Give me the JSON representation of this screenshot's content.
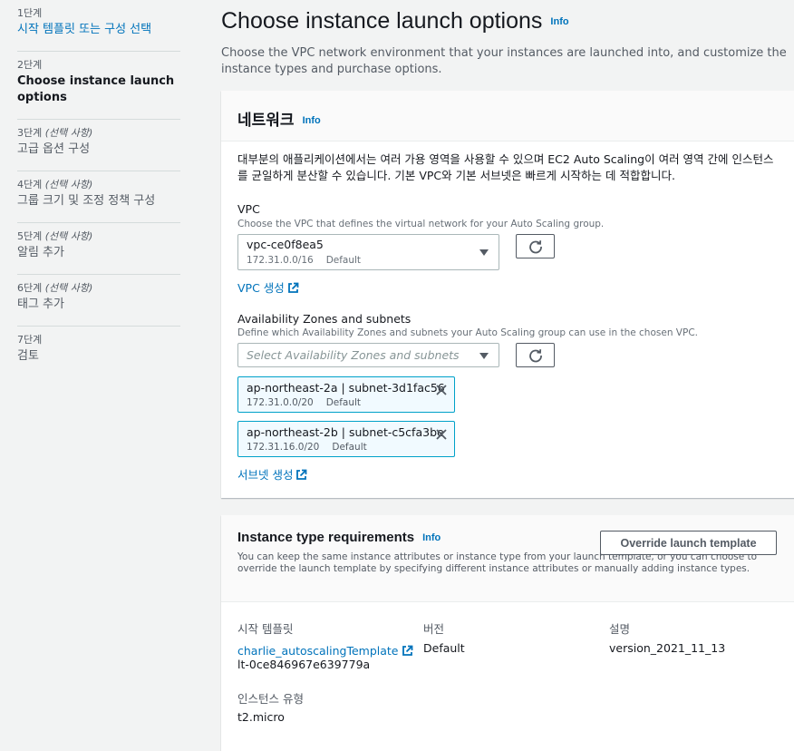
{
  "steps": [
    {
      "num": "1단계",
      "optional": "",
      "title": "시작 템플릿 또는 구성 선택"
    },
    {
      "num": "2단계",
      "optional": "",
      "title": "Choose instance launch options"
    },
    {
      "num": "3단계",
      "optional": "(선택 사항)",
      "title": "고급 옵션 구성"
    },
    {
      "num": "4단계",
      "optional": "(선택 사항)",
      "title": "그룹 크기 및 조정 정책 구성"
    },
    {
      "num": "5단계",
      "optional": "(선택 사항)",
      "title": "알림 추가"
    },
    {
      "num": "6단계",
      "optional": "(선택 사항)",
      "title": "태그 추가"
    },
    {
      "num": "7단계",
      "optional": "",
      "title": "검토"
    }
  ],
  "page": {
    "title": "Choose instance launch options",
    "info": "Info",
    "description": "Choose the VPC network environment that your instances are launched into, and customize the instance types and purchase options."
  },
  "network": {
    "title": "네트워크",
    "info": "Info",
    "description": "대부분의 애플리케이션에서는 여러 가용 영역을 사용할 수 있으며 EC2 Auto Scaling이 여러 영역 간에 인스턴스를 균일하게 분산할 수 있습니다. 기본 VPC와 기본 서브넷은 빠르게 시작하는 데 적합합니다.",
    "vpc": {
      "label": "VPC",
      "desc": "Choose the VPC that defines the virtual network for your Auto Scaling group.",
      "value": "vpc-ce0f8ea5",
      "cidr": "172.31.0.0/16",
      "tag": "Default",
      "create_link": "VPC 생성"
    },
    "az": {
      "label": "Availability Zones and subnets",
      "desc": "Define which Availability Zones and subnets your Auto Scaling group can use in the chosen VPC.",
      "placeholder": "Select Availability Zones and subnets",
      "tokens": [
        {
          "name": "ap-northeast-2a | subnet-3d1fac56",
          "cidr": "172.31.0.0/20",
          "tag": "Default"
        },
        {
          "name": "ap-northeast-2b | subnet-c5cfa3be",
          "cidr": "172.31.16.0/20",
          "tag": "Default"
        }
      ],
      "create_link": "서브넷 생성"
    }
  },
  "instance_type": {
    "title": "Instance type requirements",
    "info": "Info",
    "description": "You can keep the same instance attributes or instance type from your launch template, or you can choose to override the launch template by specifying different instance attributes or manually adding instance types.",
    "override_button": "Override launch template",
    "template_key": "시작 템플릿",
    "template_name": "charlie_autoscalingTemplate",
    "template_id": "lt-0ce846967e639779a",
    "version_key": "버전",
    "version_value": "Default",
    "desc_key": "설명",
    "desc_value": "version_2021_11_13",
    "itype_key": "인스턴스 유형",
    "itype_value": "t2.micro"
  }
}
